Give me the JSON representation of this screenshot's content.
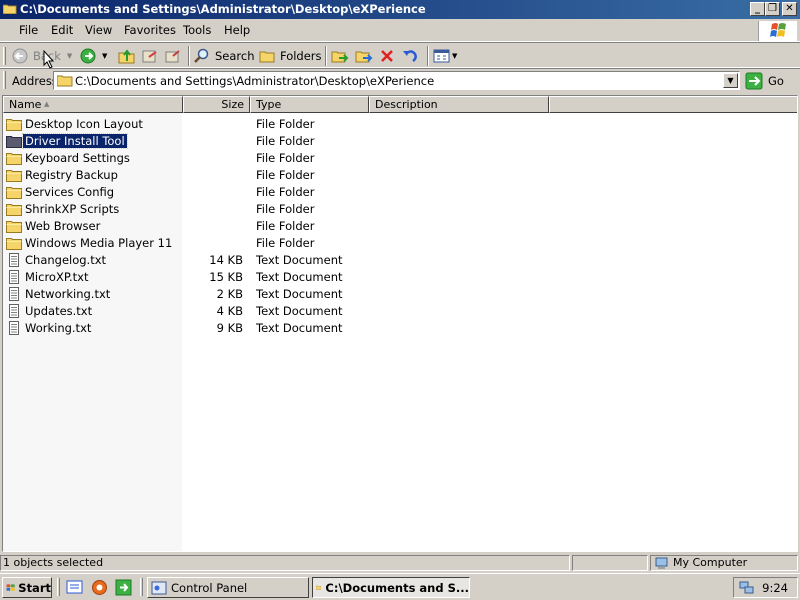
{
  "window": {
    "title": "C:\\Documents and Settings\\Administrator\\Desktop\\eXPerience",
    "min_label": "_",
    "max_label": "❐",
    "close_label": "✕"
  },
  "menu": [
    "File",
    "Edit",
    "View",
    "Favorites",
    "Tools",
    "Help"
  ],
  "toolbar": {
    "back_label": "Back",
    "search_label": "Search",
    "folders_label": "Folders"
  },
  "address": {
    "label": "Address",
    "value": "C:\\Documents and Settings\\Administrator\\Desktop\\eXPerience",
    "go_label": "Go"
  },
  "columns": {
    "name": "Name",
    "size": "Size",
    "type": "Type",
    "description": "Description"
  },
  "files": [
    {
      "name": "Desktop Icon Layout",
      "size": "",
      "type": "File Folder",
      "kind": "folder"
    },
    {
      "name": "Driver Install Tool",
      "size": "",
      "type": "File Folder",
      "kind": "folder",
      "selected": true
    },
    {
      "name": "Keyboard Settings",
      "size": "",
      "type": "File Folder",
      "kind": "folder"
    },
    {
      "name": "Registry Backup",
      "size": "",
      "type": "File Folder",
      "kind": "folder"
    },
    {
      "name": "Services Config",
      "size": "",
      "type": "File Folder",
      "kind": "folder"
    },
    {
      "name": "ShrinkXP Scripts",
      "size": "",
      "type": "File Folder",
      "kind": "folder"
    },
    {
      "name": "Web Browser",
      "size": "",
      "type": "File Folder",
      "kind": "folder"
    },
    {
      "name": "Windows Media Player 11",
      "size": "",
      "type": "File Folder",
      "kind": "folder"
    },
    {
      "name": "Changelog.txt",
      "size": "14 KB",
      "type": "Text Document",
      "kind": "text"
    },
    {
      "name": "MicroXP.txt",
      "size": "15 KB",
      "type": "Text Document",
      "kind": "text"
    },
    {
      "name": "Networking.txt",
      "size": "2 KB",
      "type": "Text Document",
      "kind": "text"
    },
    {
      "name": "Updates.txt",
      "size": "4 KB",
      "type": "Text Document",
      "kind": "text"
    },
    {
      "name": "Working.txt",
      "size": "9 KB",
      "type": "Text Document",
      "kind": "text"
    }
  ],
  "status": {
    "selection": "1 objects selected",
    "zone": "My Computer"
  },
  "taskbar": {
    "start_label": "Start",
    "tasks": [
      "Control Panel",
      "C:\\Documents and S..."
    ],
    "clock": "9:24"
  },
  "colors": {
    "title_gradient_start": "#0a246a",
    "title_gradient_end": "#3a6ea5",
    "selection": "#0a246a",
    "face": "#d4d0c8"
  }
}
